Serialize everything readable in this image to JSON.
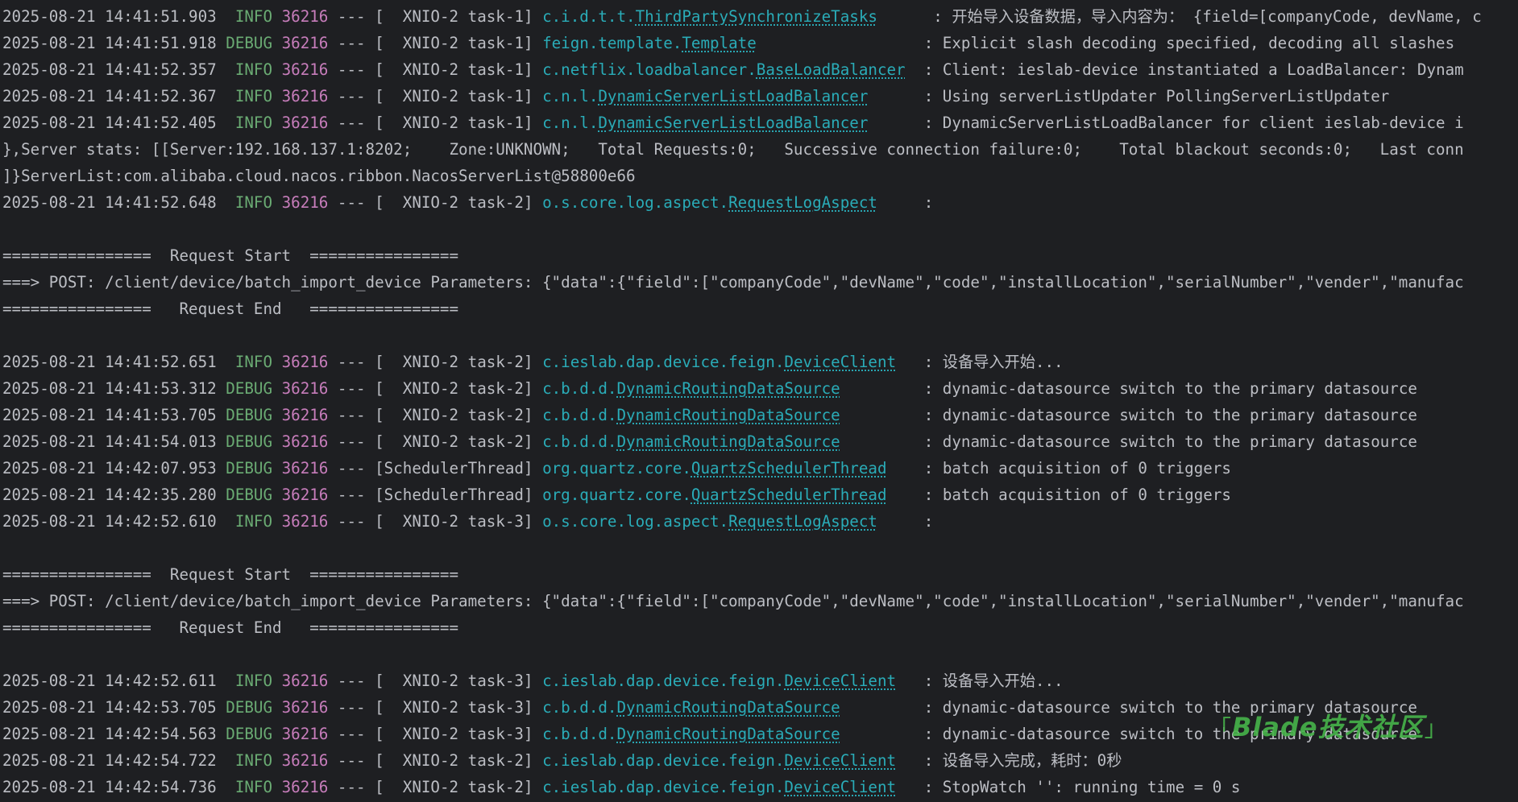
{
  "lines": [
    {
      "kind": "log",
      "ts": "2025-08-21 14:41:51.903",
      "level": " INFO",
      "pid": "36216",
      "sep": " --- ",
      "thread": "[  XNIO-2 task-1] ",
      "pkg": "c.i.d.t.t.",
      "cls": "ThirdPartySynchronizeTasks",
      "pad": "      ",
      "msg": ": 开始导入设备数据，导入内容为： {field=[companyCode, devName, c"
    },
    {
      "kind": "log",
      "ts": "2025-08-21 14:41:51.918",
      "level": "DEBUG",
      "pid": "36216",
      "sep": " --- ",
      "thread": "[  XNIO-2 task-1] ",
      "pkg": "feign.template.",
      "cls": "Template",
      "pad": "                  ",
      "msg": ": Explicit slash decoding specified, decoding all slashes"
    },
    {
      "kind": "log",
      "ts": "2025-08-21 14:41:52.357",
      "level": " INFO",
      "pid": "36216",
      "sep": " --- ",
      "thread": "[  XNIO-2 task-1] ",
      "pkg": "c.netflix.loadbalancer.",
      "cls": "BaseLoadBalancer",
      "pad": "  ",
      "msg": ": Client: ieslab-device instantiated a LoadBalancer: Dynam"
    },
    {
      "kind": "log",
      "ts": "2025-08-21 14:41:52.367",
      "level": " INFO",
      "pid": "36216",
      "sep": " --- ",
      "thread": "[  XNIO-2 task-1] ",
      "pkg": "c.n.l.",
      "cls": "DynamicServerListLoadBalancer",
      "pad": "      ",
      "msg": ": Using serverListUpdater PollingServerListUpdater"
    },
    {
      "kind": "log",
      "ts": "2025-08-21 14:41:52.405",
      "level": " INFO",
      "pid": "36216",
      "sep": " --- ",
      "thread": "[  XNIO-2 task-1] ",
      "pkg": "c.n.l.",
      "cls": "DynamicServerListLoadBalancer",
      "pad": "      ",
      "msg": ": DynamicServerListLoadBalancer for client ieslab-device i"
    },
    {
      "kind": "text",
      "text": "},Server stats: [[Server:192.168.137.1:8202;    Zone:UNKNOWN;   Total Requests:0;   Successive connection failure:0;    Total blackout seconds:0;   Last conn"
    },
    {
      "kind": "text",
      "text": "]}ServerList:com.alibaba.cloud.nacos.ribbon.NacosServerList@58800e66"
    },
    {
      "kind": "log",
      "ts": "2025-08-21 14:41:52.648",
      "level": " INFO",
      "pid": "36216",
      "sep": " --- ",
      "thread": "[  XNIO-2 task-2] ",
      "pkg": "o.s.core.log.aspect.",
      "cls": "RequestLogAspect",
      "pad": "     ",
      "msg": ":"
    },
    {
      "kind": "text",
      "text": ""
    },
    {
      "kind": "text",
      "text": "================  Request Start  ================"
    },
    {
      "kind": "text",
      "text": "===> POST: /client/device/batch_import_device Parameters: {\"data\":{\"field\":[\"companyCode\",\"devName\",\"code\",\"installLocation\",\"serialNumber\",\"vender\",\"manufac"
    },
    {
      "kind": "text",
      "text": "================   Request End   ================"
    },
    {
      "kind": "text",
      "text": ""
    },
    {
      "kind": "log",
      "ts": "2025-08-21 14:41:52.651",
      "level": " INFO",
      "pid": "36216",
      "sep": " --- ",
      "thread": "[  XNIO-2 task-2] ",
      "pkg": "c.ieslab.dap.device.feign.",
      "cls": "DeviceClient",
      "pad": "   ",
      "msg": ": 设备导入开始..."
    },
    {
      "kind": "log",
      "ts": "2025-08-21 14:41:53.312",
      "level": "DEBUG",
      "pid": "36216",
      "sep": " --- ",
      "thread": "[  XNIO-2 task-2] ",
      "pkg": "c.b.d.d.",
      "cls": "DynamicRoutingDataSource",
      "pad": "         ",
      "msg": ": dynamic-datasource switch to the primary datasource"
    },
    {
      "kind": "log",
      "ts": "2025-08-21 14:41:53.705",
      "level": "DEBUG",
      "pid": "36216",
      "sep": " --- ",
      "thread": "[  XNIO-2 task-2] ",
      "pkg": "c.b.d.d.",
      "cls": "DynamicRoutingDataSource",
      "pad": "         ",
      "msg": ": dynamic-datasource switch to the primary datasource"
    },
    {
      "kind": "log",
      "ts": "2025-08-21 14:41:54.013",
      "level": "DEBUG",
      "pid": "36216",
      "sep": " --- ",
      "thread": "[  XNIO-2 task-2] ",
      "pkg": "c.b.d.d.",
      "cls": "DynamicRoutingDataSource",
      "pad": "         ",
      "msg": ": dynamic-datasource switch to the primary datasource"
    },
    {
      "kind": "log",
      "ts": "2025-08-21 14:42:07.953",
      "level": "DEBUG",
      "pid": "36216",
      "sep": " --- ",
      "thread": "[SchedulerThread] ",
      "pkg": "org.quartz.core.",
      "cls": "QuartzSchedulerThread",
      "pad": "    ",
      "msg": ": batch acquisition of 0 triggers"
    },
    {
      "kind": "log",
      "ts": "2025-08-21 14:42:35.280",
      "level": "DEBUG",
      "pid": "36216",
      "sep": " --- ",
      "thread": "[SchedulerThread] ",
      "pkg": "org.quartz.core.",
      "cls": "QuartzSchedulerThread",
      "pad": "    ",
      "msg": ": batch acquisition of 0 triggers"
    },
    {
      "kind": "log",
      "ts": "2025-08-21 14:42:52.610",
      "level": " INFO",
      "pid": "36216",
      "sep": " --- ",
      "thread": "[  XNIO-2 task-3] ",
      "pkg": "o.s.core.log.aspect.",
      "cls": "RequestLogAspect",
      "pad": "     ",
      "msg": ":"
    },
    {
      "kind": "text",
      "text": ""
    },
    {
      "kind": "text",
      "text": "================  Request Start  ================"
    },
    {
      "kind": "text",
      "text": "===> POST: /client/device/batch_import_device Parameters: {\"data\":{\"field\":[\"companyCode\",\"devName\",\"code\",\"installLocation\",\"serialNumber\",\"vender\",\"manufac"
    },
    {
      "kind": "text",
      "text": "================   Request End   ================"
    },
    {
      "kind": "text",
      "text": ""
    },
    {
      "kind": "log",
      "ts": "2025-08-21 14:42:52.611",
      "level": " INFO",
      "pid": "36216",
      "sep": " --- ",
      "thread": "[  XNIO-2 task-3] ",
      "pkg": "c.ieslab.dap.device.feign.",
      "cls": "DeviceClient",
      "pad": "   ",
      "msg": ": 设备导入开始..."
    },
    {
      "kind": "log",
      "ts": "2025-08-21 14:42:53.705",
      "level": "DEBUG",
      "pid": "36216",
      "sep": " --- ",
      "thread": "[  XNIO-2 task-3] ",
      "pkg": "c.b.d.d.",
      "cls": "DynamicRoutingDataSource",
      "pad": "         ",
      "msg": ": dynamic-datasource switch to the primary datasource"
    },
    {
      "kind": "log",
      "ts": "2025-08-21 14:42:54.563",
      "level": "DEBUG",
      "pid": "36216",
      "sep": " --- ",
      "thread": "[  XNIO-2 task-3] ",
      "pkg": "c.b.d.d.",
      "cls": "DynamicRoutingDataSource",
      "pad": "         ",
      "msg": ": dynamic-datasource switch to the primary datasource"
    },
    {
      "kind": "log",
      "ts": "2025-08-21 14:42:54.722",
      "level": " INFO",
      "pid": "36216",
      "sep": " --- ",
      "thread": "[  XNIO-2 task-2] ",
      "pkg": "c.ieslab.dap.device.feign.",
      "cls": "DeviceClient",
      "pad": "   ",
      "msg": ": 设备导入完成，耗时：0秒"
    },
    {
      "kind": "log",
      "ts": "2025-08-21 14:42:54.736",
      "level": " INFO",
      "pid": "36216",
      "sep": " --- ",
      "thread": "[  XNIO-2 task-2] ",
      "pkg": "c.ieslab.dap.device.feign.",
      "cls": "DeviceClient",
      "pad": "   ",
      "msg": ": StopWatch '': running time = 0 s"
    }
  ],
  "watermark": {
    "text": "Blade技术社区",
    "open": "「",
    "close": "」"
  },
  "colors": {
    "background": "#1e1f22",
    "text": "#bcbec4",
    "level": "#6aab73",
    "pid": "#c77dbb",
    "logger": "#2aacb8",
    "watermark": "#47b44a"
  }
}
